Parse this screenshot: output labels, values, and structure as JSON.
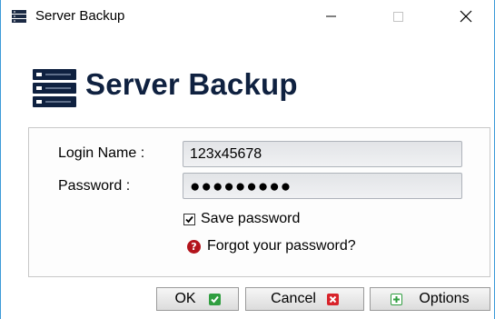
{
  "window": {
    "title": "Server Backup",
    "icon": "server-icon",
    "controls": {
      "minimize": "—",
      "maximize": "☐",
      "close": "✕"
    }
  },
  "header": {
    "title": "Server Backup",
    "icon": "server-stack-icon",
    "title_color": "#0f2140"
  },
  "form": {
    "login_label": "Login Name :",
    "login_value": "123x45678",
    "password_label": "Password :",
    "password_value": "●●●●●●●●●",
    "save_password_label": "Save password",
    "save_password_checked": true,
    "forgot_label": "Forgot your password?"
  },
  "buttons": {
    "ok": "OK",
    "cancel": "Cancel",
    "options": "Options"
  },
  "colors": {
    "accent_border": "#3c9ad8",
    "ok_green": "#2f9e3f",
    "cancel_red": "#d8232a",
    "help_red": "#b3141c"
  }
}
